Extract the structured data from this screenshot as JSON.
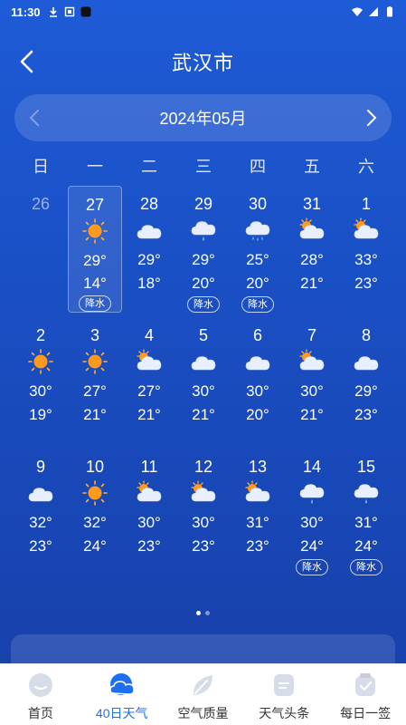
{
  "status_bar": {
    "time": "11:30"
  },
  "header": {
    "title": "武汉市"
  },
  "month_selector": {
    "label": "2024年05月"
  },
  "weekdays": [
    "日",
    "一",
    "二",
    "三",
    "四",
    "五",
    "六"
  ],
  "days": [
    {
      "num": "26",
      "muted": true,
      "icon": "",
      "hi": "",
      "lo": "",
      "badge": ""
    },
    {
      "num": "27",
      "selected": true,
      "icon": "sun",
      "hi": "29°",
      "lo": "14°",
      "badge": "降水"
    },
    {
      "num": "28",
      "icon": "cloud",
      "hi": "29°",
      "lo": "18°",
      "badge": ""
    },
    {
      "num": "29",
      "icon": "rain",
      "hi": "29°",
      "lo": "20°",
      "badge": "降水"
    },
    {
      "num": "30",
      "icon": "heavy-rain",
      "hi": "25°",
      "lo": "20°",
      "badge": "降水"
    },
    {
      "num": "31",
      "icon": "partly",
      "hi": "28°",
      "lo": "21°",
      "badge": ""
    },
    {
      "num": "1",
      "icon": "partly",
      "hi": "33°",
      "lo": "23°",
      "badge": ""
    },
    {
      "num": "2",
      "icon": "sun",
      "hi": "30°",
      "lo": "19°",
      "badge": ""
    },
    {
      "num": "3",
      "icon": "sun",
      "hi": "27°",
      "lo": "21°",
      "badge": ""
    },
    {
      "num": "4",
      "icon": "partly",
      "hi": "27°",
      "lo": "21°",
      "badge": ""
    },
    {
      "num": "5",
      "icon": "cloud",
      "hi": "30°",
      "lo": "21°",
      "badge": ""
    },
    {
      "num": "6",
      "icon": "cloud",
      "hi": "30°",
      "lo": "20°",
      "badge": ""
    },
    {
      "num": "7",
      "icon": "partly",
      "hi": "30°",
      "lo": "21°",
      "badge": ""
    },
    {
      "num": "8",
      "icon": "cloud",
      "hi": "29°",
      "lo": "23°",
      "badge": ""
    },
    {
      "num": "9",
      "icon": "cloud",
      "hi": "32°",
      "lo": "23°",
      "badge": ""
    },
    {
      "num": "10",
      "icon": "sun",
      "hi": "32°",
      "lo": "24°",
      "badge": ""
    },
    {
      "num": "11",
      "icon": "partly",
      "hi": "30°",
      "lo": "23°",
      "badge": ""
    },
    {
      "num": "12",
      "icon": "partly",
      "hi": "30°",
      "lo": "23°",
      "badge": ""
    },
    {
      "num": "13",
      "icon": "partly",
      "hi": "31°",
      "lo": "23°",
      "badge": ""
    },
    {
      "num": "14",
      "icon": "rain",
      "hi": "30°",
      "lo": "24°",
      "badge": "降水"
    },
    {
      "num": "15",
      "icon": "rain",
      "hi": "31°",
      "lo": "24°",
      "badge": "降水"
    }
  ],
  "tabs": [
    {
      "label": "首页",
      "icon": "home-icon",
      "active": false
    },
    {
      "label": "40日天气",
      "icon": "forty-day-weather-icon",
      "active": true
    },
    {
      "label": "空气质量",
      "icon": "air-quality-leaf-icon",
      "active": false
    },
    {
      "label": "天气头条",
      "icon": "news-icon",
      "active": false
    },
    {
      "label": "每日一签",
      "icon": "daily-sign-icon",
      "active": false
    }
  ],
  "colors": {
    "accent": "#1e6ff0",
    "background": "#1a4fc4",
    "sun": "#ff9a1f"
  }
}
